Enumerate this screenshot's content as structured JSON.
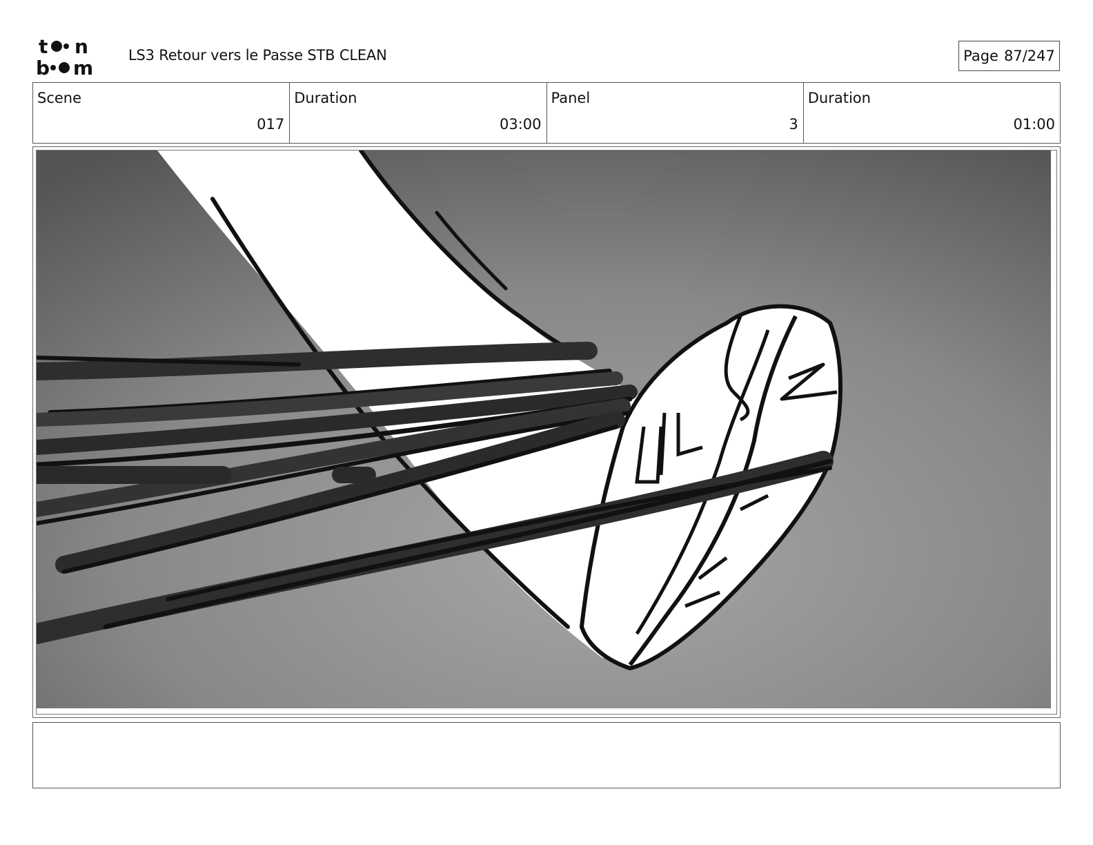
{
  "header": {
    "logo_text": "toon boom",
    "title": "LS3 Retour vers le Passe STB CLEAN",
    "page_label": "Page",
    "page_value": "87/247"
  },
  "info": {
    "scene_label": "Scene",
    "scene_value": "017",
    "scene_duration_label": "Duration",
    "scene_duration_value": "03:00",
    "panel_label": "Panel",
    "panel_value": "3",
    "panel_duration_label": "Duration",
    "panel_duration_value": "01:00"
  },
  "caption": {
    "text": ""
  }
}
